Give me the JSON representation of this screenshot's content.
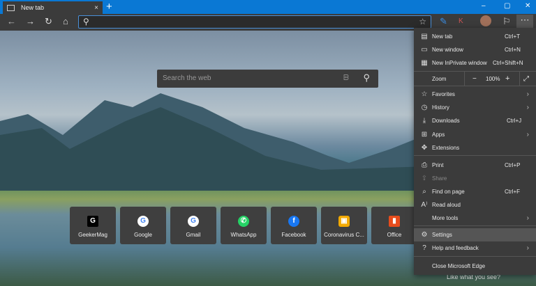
{
  "tab": {
    "title": "New tab",
    "close": "×",
    "new": "+"
  },
  "window": {
    "minimize": "–",
    "restore": "▢",
    "close": "✕"
  },
  "search": {
    "placeholder": "Search the web"
  },
  "tiles": [
    {
      "label": "GeekerMag",
      "icon": "G",
      "color": "#000000"
    },
    {
      "label": "Google",
      "icon": "G",
      "color": "#ffffff"
    },
    {
      "label": "Gmail",
      "icon": "G",
      "color": "#ffffff"
    },
    {
      "label": "WhatsApp",
      "icon": "✆",
      "color": "#25d366"
    },
    {
      "label": "Facebook",
      "icon": "f",
      "color": "#1877f2"
    },
    {
      "label": "Coronavirus C...",
      "icon": "▣",
      "color": "#f2a900"
    },
    {
      "label": "Office",
      "icon": "▮",
      "color": "#e74c1c"
    }
  ],
  "like": "Like what you see?",
  "menu": {
    "new_tab": {
      "label": "New tab",
      "key": "Ctrl+T"
    },
    "new_window": {
      "label": "New window",
      "key": "Ctrl+N"
    },
    "inprivate": {
      "label": "New InPrivate window",
      "key": "Ctrl+Shift+N"
    },
    "zoom": {
      "label": "Zoom",
      "minus": "−",
      "value": "100%",
      "plus": "+"
    },
    "favorites": "Favorites",
    "history": "History",
    "downloads": {
      "label": "Downloads",
      "key": "Ctrl+J"
    },
    "apps": "Apps",
    "extensions": "Extensions",
    "print": {
      "label": "Print",
      "key": "Ctrl+P"
    },
    "share": "Share",
    "find": {
      "label": "Find on page",
      "key": "Ctrl+F"
    },
    "read_aloud": "Read aloud",
    "more_tools": "More tools",
    "settings": "Settings",
    "help": "Help and feedback",
    "close": "Close Microsoft Edge"
  }
}
